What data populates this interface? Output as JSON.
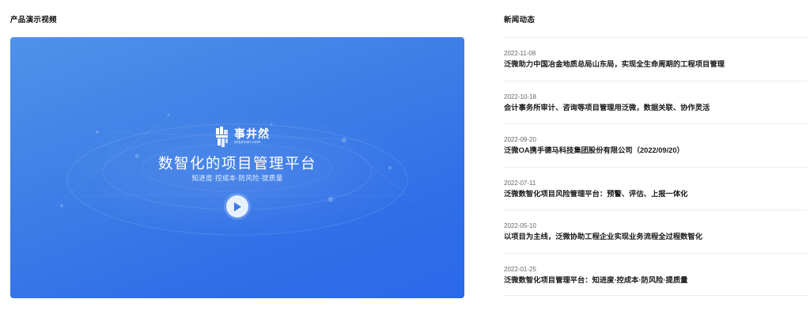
{
  "video_section": {
    "title": "产品演示视频",
    "brand_name": "事井然",
    "brand_domain": "shijinran.com",
    "headline": "数智化的项目管理平台",
    "slogan": "知进度·控成本·防风险·提质量",
    "play_icon": "play-icon",
    "gradient_start": "#4f92ea",
    "gradient_end": "#2a69ea"
  },
  "news_section": {
    "title": "新闻动态",
    "items": [
      {
        "date": "2022-11-08",
        "headline": "泛微助力中国冶金地质总局山东局，实现全生命周期的工程项目管理"
      },
      {
        "date": "2022-10-18",
        "headline": "会计事务所审计、咨询等项目管理用泛微，数据关联、协作灵活"
      },
      {
        "date": "2022-09-20",
        "headline": "泛微OA携手德马科技集团股份有限公司（2022/09/20）"
      },
      {
        "date": "2022-07-11",
        "headline": "泛微数智化项目风险管理平台：预警、评估、上报一体化"
      },
      {
        "date": "2022-05-10",
        "headline": "以项目为主线，泛微协助工程企业实现业务流程全过程数智化"
      },
      {
        "date": "2022-01-25",
        "headline": "泛微数智化项目管理平台：知进度·控成本·防风险·提质量"
      }
    ]
  }
}
